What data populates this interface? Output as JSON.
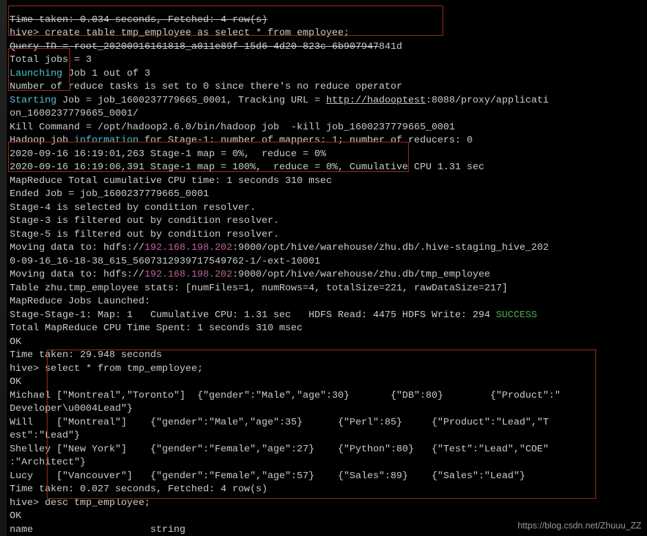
{
  "lines": {
    "l0a": "Time taken: 0.034 seconds, Fetched: 4 row(s)",
    "l0b_prompt": "hive> ",
    "l0b_cmd": "create table tmp_employee as select * from employee;",
    "l1_a": "Query ID = root_20200916161818_a011e89f-15d6-4d20-823c-6b907947",
    "l1_b": "841d",
    "l2": "Total jobs = 3",
    "l3_a": "Launching",
    "l3_b": " Job 1 out of 3",
    "l4": "Number of reduce tasks is set to 0 since there's no reduce operator",
    "l5_a": "Starting",
    "l5_b": " Job = job_1600237779665_0001, Tracking URL = ",
    "l5_c": "http://hadooptest",
    "l5_d": ":8088/proxy/applicati",
    "l6": "on_1600237779665_0001/",
    "l7": "Kill Command = /opt/hadoop2.6.0/bin/hadoop job  -kill job_1600237779665_0001",
    "l8_a": "Hadoop job ",
    "l8_b": "information",
    "l8_c": " for Stage-1: number of mappers: 1; number of reducers: 0",
    "l9": "2020-09-16 16:19:01,263 Stage-1 map = 0%,  reduce = 0%",
    "l10": "2020-09-16 16:19:06,391 Stage-1 map = 100%,  reduce = 0%, Cumulative CPU 1.31 sec",
    "l11": "MapReduce Total cumulative CPU time: 1 seconds 310 msec",
    "l12": "Ended Job = job_1600237779665_0001",
    "l13": "Stage-4 is selected by condition resolver.",
    "l14": "Stage-3 is filtered out by condition resolver.",
    "l15": "Stage-5 is filtered out by condition resolver.",
    "l16_a": "Moving data to: hdfs://",
    "l16_b": "192.168.198.202",
    "l16_c": ":9000/opt/hive/warehouse/zhu.db/.hive-staging_hive_202",
    "l17": "0-09-16_16-18-38_615_5607312939717549762-1/-ext-10001",
    "l18_a": "Moving data to: hdfs://",
    "l18_b": "192.168.198.202",
    "l18_c": ":9000/opt/hive/warehouse/zhu.db/tmp_employee",
    "l19": "Table zhu.tmp_employee stats: [numFiles=1, numRows=4, totalSize=221, rawDataSize=217]",
    "l20": "MapReduce Jobs Launched:",
    "l21_a": "Stage-Stage-1: Map: 1   Cumulative CPU: 1.31 sec   HDFS Read: 4475 HDFS Write: 294 ",
    "l21_b": "SUCCESS",
    "l22": "Total MapReduce CPU Time Spent: 1 seconds 310 msec",
    "l23": "OK",
    "l24": "Time taken: 29.948 seconds",
    "l25_prompt": "hive> ",
    "l25_cmd": "select * from tmp_employee;",
    "l26": "OK",
    "l27": "Michael [\"Montreal\",\"Toronto\"]  {\"gender\":\"Male\",\"age\":30}       {\"DB\":80}        {\"Product\":\"",
    "l28": "Developer\\u0004Lead\"}",
    "l29": "Will    [\"Montreal\"]    {\"gender\":\"Male\",\"age\":35}      {\"Perl\":85}     {\"Product\":\"Lead\",\"T",
    "l30": "est\":\"Lead\"}",
    "l31": "Shelley [\"New York\"]    {\"gender\":\"Female\",\"age\":27}    {\"Python\":80}   {\"Test\":\"Lead\",\"COE\"",
    "l32": ":\"Architect\"}",
    "l33": "Lucy    [\"Vancouver\"]   {\"gender\":\"Female\",\"age\":57}    {\"Sales\":89}    {\"Sales\":\"Lead\"}",
    "l34": "Time taken: 0.027 seconds, Fetched: 4 row(s)",
    "l35_prompt": "hive> ",
    "l35_cmd": "desc tmp_employee;",
    "l36": "OK",
    "l37": "name                    string"
  },
  "watermark": "https://blog.csdn.net/Zhuuu_ZZ"
}
